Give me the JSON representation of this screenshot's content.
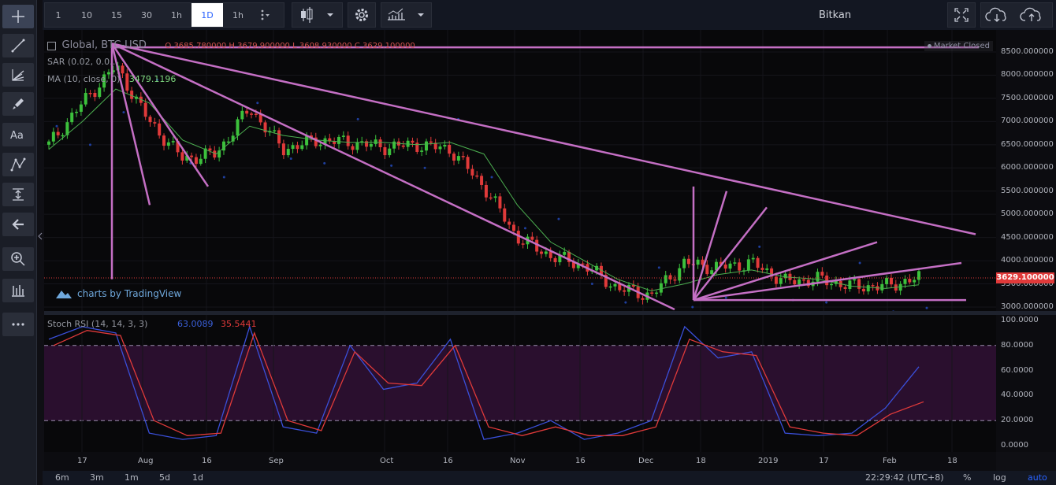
{
  "app": {
    "title": "Bitkan"
  },
  "toolbar": {
    "intervals": [
      "1",
      "10",
      "15",
      "30",
      "1h",
      "1D",
      "1h"
    ],
    "active_interval": "1D"
  },
  "legend": {
    "symbol": "Global, BTC-USD",
    "ohlc": "O 3685.780000  H 3679.900000  L 3608.930000  C 3629.100000",
    "sar": "SAR (0.02, 0.0…",
    "ma": "MA (10, close, 0)",
    "ma_value": "3479.1196",
    "stoch": "Stoch RSI (14, 14, 3, 3)",
    "stoch_k": "63.0089",
    "stoch_d": "35.5441"
  },
  "badges": {
    "market_closed": "Market Closed",
    "tradingview": "charts by TradingView"
  },
  "price_axis": {
    "labels": [
      "8500.000000",
      "8000.000000",
      "7500.000000",
      "7000.000000",
      "6500.000000",
      "6000.000000",
      "5500.000000",
      "5000.000000",
      "4500.000000",
      "4000.000000",
      "3500.000000",
      "3000.000000"
    ],
    "current_price": "3629.100000"
  },
  "rsi_axis": {
    "labels": [
      "100.0000",
      "80.0000",
      "60.0000",
      "40.0000",
      "20.0000",
      "0.0000"
    ]
  },
  "time_axis": {
    "labels": [
      "17",
      "Aug",
      "16",
      "Sep",
      "Oct",
      "16",
      "Nov",
      "16",
      "Dec",
      "18",
      "2019",
      "17",
      "Feb",
      "18"
    ]
  },
  "bottom": {
    "ranges": [
      "6m",
      "3m",
      "1m",
      "5d",
      "1d"
    ],
    "clock": "22:29:42 (UTC+8)",
    "percent": "%",
    "log": "log",
    "auto": "auto"
  },
  "chart_data": {
    "type": "candlestick",
    "x": [
      "Jul 10",
      "Jul 20",
      "Jul 28",
      "Aug 5",
      "Aug 15",
      "Aug 25",
      "Sep 5",
      "Sep 15",
      "Sep 25",
      "Oct 5",
      "Oct 15",
      "Oct 25",
      "Nov 5",
      "Nov 14",
      "Nov 20",
      "Nov 25",
      "Dec 1",
      "Dec 8",
      "Dec 15",
      "Dec 22",
      "Dec 29",
      "Jan 5",
      "Jan 12",
      "Jan 20",
      "Jan 28",
      "Feb 3",
      "Feb 8"
    ],
    "close": [
      6500,
      7400,
      8200,
      7000,
      6200,
      6300,
      7300,
      6400,
      6600,
      6550,
      6450,
      6500,
      6400,
      5600,
      4500,
      4100,
      3900,
      3400,
      3250,
      3950,
      3850,
      3950,
      3550,
      3600,
      3450,
      3450,
      3629
    ],
    "ma": [
      6400,
      7000,
      7700,
      7400,
      6600,
      6300,
      6900,
      6700,
      6600,
      6550,
      6550,
      6500,
      6550,
      6300,
      5200,
      4400,
      4000,
      3600,
      3350,
      3500,
      3700,
      3800,
      3650,
      3600,
      3450,
      3400,
      3480
    ],
    "rsi_k": [
      85,
      95,
      90,
      10,
      5,
      8,
      95,
      15,
      10,
      80,
      45,
      50,
      85,
      5,
      10,
      20,
      5,
      10,
      20,
      95,
      70,
      75,
      10,
      8,
      10,
      30,
      63
    ],
    "rsi_d": [
      80,
      92,
      88,
      20,
      8,
      10,
      90,
      20,
      12,
      75,
      50,
      48,
      80,
      15,
      8,
      15,
      8,
      8,
      15,
      85,
      75,
      72,
      15,
      10,
      8,
      25,
      35
    ],
    "ylim": [
      2900,
      8900
    ],
    "rsi_ylim": [
      0,
      100
    ]
  }
}
